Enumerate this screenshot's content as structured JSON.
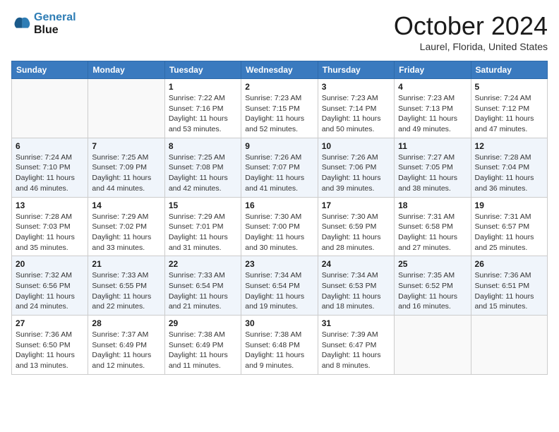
{
  "header": {
    "logo_line1": "General",
    "logo_line2": "Blue",
    "month_title": "October 2024",
    "location": "Laurel, Florida, United States"
  },
  "calendar": {
    "weekdays": [
      "Sunday",
      "Monday",
      "Tuesday",
      "Wednesday",
      "Thursday",
      "Friday",
      "Saturday"
    ],
    "weeks": [
      [
        {
          "day": "",
          "info": ""
        },
        {
          "day": "",
          "info": ""
        },
        {
          "day": "1",
          "info": "Sunrise: 7:22 AM\nSunset: 7:16 PM\nDaylight: 11 hours\nand 53 minutes."
        },
        {
          "day": "2",
          "info": "Sunrise: 7:23 AM\nSunset: 7:15 PM\nDaylight: 11 hours\nand 52 minutes."
        },
        {
          "day": "3",
          "info": "Sunrise: 7:23 AM\nSunset: 7:14 PM\nDaylight: 11 hours\nand 50 minutes."
        },
        {
          "day": "4",
          "info": "Sunrise: 7:23 AM\nSunset: 7:13 PM\nDaylight: 11 hours\nand 49 minutes."
        },
        {
          "day": "5",
          "info": "Sunrise: 7:24 AM\nSunset: 7:12 PM\nDaylight: 11 hours\nand 47 minutes."
        }
      ],
      [
        {
          "day": "6",
          "info": "Sunrise: 7:24 AM\nSunset: 7:10 PM\nDaylight: 11 hours\nand 46 minutes."
        },
        {
          "day": "7",
          "info": "Sunrise: 7:25 AM\nSunset: 7:09 PM\nDaylight: 11 hours\nand 44 minutes."
        },
        {
          "day": "8",
          "info": "Sunrise: 7:25 AM\nSunset: 7:08 PM\nDaylight: 11 hours\nand 42 minutes."
        },
        {
          "day": "9",
          "info": "Sunrise: 7:26 AM\nSunset: 7:07 PM\nDaylight: 11 hours\nand 41 minutes."
        },
        {
          "day": "10",
          "info": "Sunrise: 7:26 AM\nSunset: 7:06 PM\nDaylight: 11 hours\nand 39 minutes."
        },
        {
          "day": "11",
          "info": "Sunrise: 7:27 AM\nSunset: 7:05 PM\nDaylight: 11 hours\nand 38 minutes."
        },
        {
          "day": "12",
          "info": "Sunrise: 7:28 AM\nSunset: 7:04 PM\nDaylight: 11 hours\nand 36 minutes."
        }
      ],
      [
        {
          "day": "13",
          "info": "Sunrise: 7:28 AM\nSunset: 7:03 PM\nDaylight: 11 hours\nand 35 minutes."
        },
        {
          "day": "14",
          "info": "Sunrise: 7:29 AM\nSunset: 7:02 PM\nDaylight: 11 hours\nand 33 minutes."
        },
        {
          "day": "15",
          "info": "Sunrise: 7:29 AM\nSunset: 7:01 PM\nDaylight: 11 hours\nand 31 minutes."
        },
        {
          "day": "16",
          "info": "Sunrise: 7:30 AM\nSunset: 7:00 PM\nDaylight: 11 hours\nand 30 minutes."
        },
        {
          "day": "17",
          "info": "Sunrise: 7:30 AM\nSunset: 6:59 PM\nDaylight: 11 hours\nand 28 minutes."
        },
        {
          "day": "18",
          "info": "Sunrise: 7:31 AM\nSunset: 6:58 PM\nDaylight: 11 hours\nand 27 minutes."
        },
        {
          "day": "19",
          "info": "Sunrise: 7:31 AM\nSunset: 6:57 PM\nDaylight: 11 hours\nand 25 minutes."
        }
      ],
      [
        {
          "day": "20",
          "info": "Sunrise: 7:32 AM\nSunset: 6:56 PM\nDaylight: 11 hours\nand 24 minutes."
        },
        {
          "day": "21",
          "info": "Sunrise: 7:33 AM\nSunset: 6:55 PM\nDaylight: 11 hours\nand 22 minutes."
        },
        {
          "day": "22",
          "info": "Sunrise: 7:33 AM\nSunset: 6:54 PM\nDaylight: 11 hours\nand 21 minutes."
        },
        {
          "day": "23",
          "info": "Sunrise: 7:34 AM\nSunset: 6:54 PM\nDaylight: 11 hours\nand 19 minutes."
        },
        {
          "day": "24",
          "info": "Sunrise: 7:34 AM\nSunset: 6:53 PM\nDaylight: 11 hours\nand 18 minutes."
        },
        {
          "day": "25",
          "info": "Sunrise: 7:35 AM\nSunset: 6:52 PM\nDaylight: 11 hours\nand 16 minutes."
        },
        {
          "day": "26",
          "info": "Sunrise: 7:36 AM\nSunset: 6:51 PM\nDaylight: 11 hours\nand 15 minutes."
        }
      ],
      [
        {
          "day": "27",
          "info": "Sunrise: 7:36 AM\nSunset: 6:50 PM\nDaylight: 11 hours\nand 13 minutes."
        },
        {
          "day": "28",
          "info": "Sunrise: 7:37 AM\nSunset: 6:49 PM\nDaylight: 11 hours\nand 12 minutes."
        },
        {
          "day": "29",
          "info": "Sunrise: 7:38 AM\nSunset: 6:49 PM\nDaylight: 11 hours\nand 11 minutes."
        },
        {
          "day": "30",
          "info": "Sunrise: 7:38 AM\nSunset: 6:48 PM\nDaylight: 11 hours\nand 9 minutes."
        },
        {
          "day": "31",
          "info": "Sunrise: 7:39 AM\nSunset: 6:47 PM\nDaylight: 11 hours\nand 8 minutes."
        },
        {
          "day": "",
          "info": ""
        },
        {
          "day": "",
          "info": ""
        }
      ]
    ]
  }
}
